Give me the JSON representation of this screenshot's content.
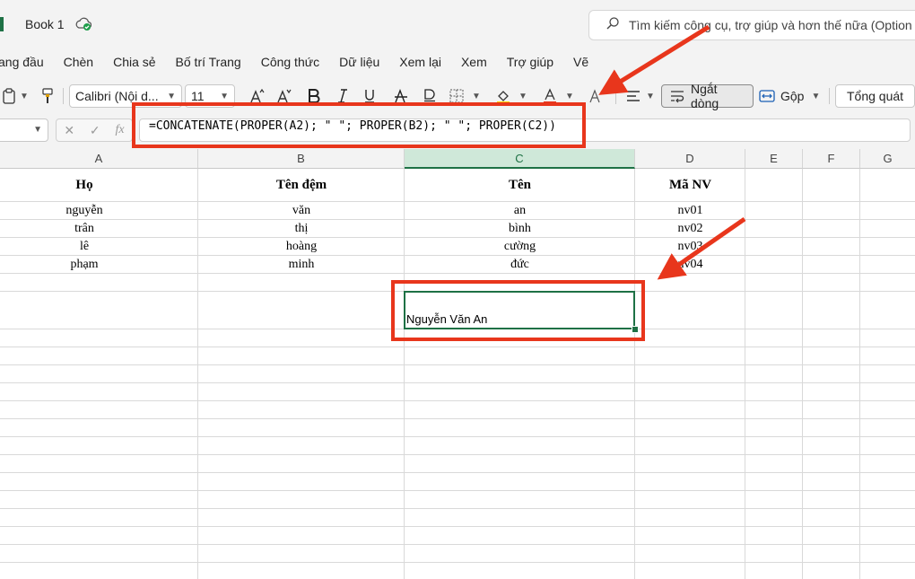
{
  "title_bar": {
    "doc_title": "Book 1",
    "search_placeholder": "Tìm kiếm công cụ, trợ giúp và hơn thế nữa (Option"
  },
  "tabs": [
    "ang đầu",
    "Chèn",
    "Chia sẻ",
    "Bố trí Trang",
    "Công thức",
    "Dữ liệu",
    "Xem lại",
    "Xem",
    "Trợ giúp",
    "Vẽ"
  ],
  "ribbon": {
    "font_name": "Calibri (Nội d...",
    "font_size": "11",
    "wrap_text": "Ngắt dòng",
    "merge": "Gộp",
    "number_format": "Tổng quát",
    "font_color": "#e8361c",
    "fill_color": "#ffd400"
  },
  "formula_bar": {
    "formula": "=CONCATENATE(PROPER(A2); \" \"; PROPER(B2); \" \"; PROPER(C2))"
  },
  "sheet": {
    "columns": [
      "A",
      "B",
      "C",
      "D",
      "E",
      "F",
      "G"
    ],
    "active_column": "C",
    "header_row": [
      "Họ",
      "Tên đệm",
      "Tên",
      "Mã NV"
    ],
    "rows": [
      [
        "nguyễn",
        "văn",
        "an",
        "nv01"
      ],
      [
        "trân",
        "thị",
        "bình",
        "nv02"
      ],
      [
        "lê",
        "hoàng",
        "cường",
        "nv03"
      ],
      [
        "phạm",
        "minh",
        "đức",
        "nv04"
      ]
    ],
    "result_value": "Nguyễn Văn An"
  },
  "annotation_color": "#e8361c"
}
